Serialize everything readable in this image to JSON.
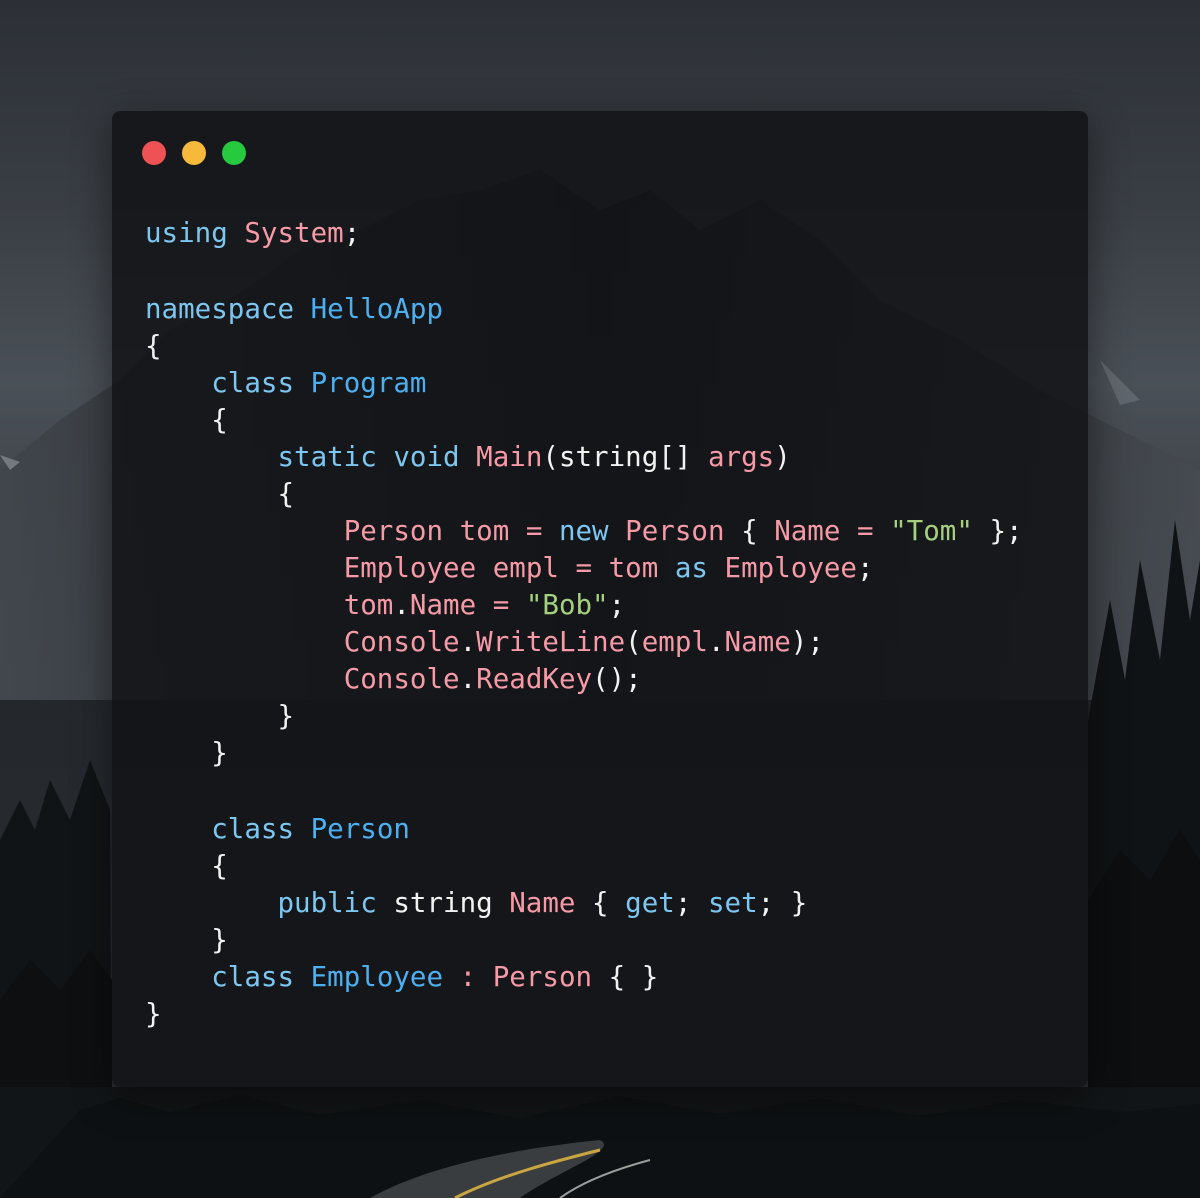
{
  "window": {
    "controls": [
      {
        "name": "close",
        "color": "#ef5254"
      },
      {
        "name": "minimize",
        "color": "#f6b93b"
      },
      {
        "name": "maximize",
        "color": "#27c93f"
      }
    ]
  },
  "colors": {
    "keyword": "#7cc6f0",
    "type": "#4cb0f0",
    "identifier": "#f59aa6",
    "string": "#a5d17f",
    "plain": "#f2f2f2"
  },
  "code_lines": [
    [
      {
        "t": "using",
        "c": "keyword"
      },
      {
        "t": " ",
        "c": "plain"
      },
      {
        "t": "System",
        "c": "identifier"
      },
      {
        "t": ";",
        "c": "plain"
      }
    ],
    [],
    [
      {
        "t": "namespace",
        "c": "keyword"
      },
      {
        "t": " ",
        "c": "plain"
      },
      {
        "t": "HelloApp",
        "c": "type"
      }
    ],
    [
      {
        "t": "{",
        "c": "plain"
      }
    ],
    [
      {
        "t": "    ",
        "c": "plain"
      },
      {
        "t": "class",
        "c": "keyword"
      },
      {
        "t": " ",
        "c": "plain"
      },
      {
        "t": "Program",
        "c": "type"
      }
    ],
    [
      {
        "t": "    {",
        "c": "plain"
      }
    ],
    [
      {
        "t": "        ",
        "c": "plain"
      },
      {
        "t": "static",
        "c": "keyword"
      },
      {
        "t": " ",
        "c": "plain"
      },
      {
        "t": "void",
        "c": "keyword"
      },
      {
        "t": " ",
        "c": "plain"
      },
      {
        "t": "Main",
        "c": "identifier"
      },
      {
        "t": "(string[] ",
        "c": "plain"
      },
      {
        "t": "args",
        "c": "identifier"
      },
      {
        "t": ")",
        "c": "plain"
      }
    ],
    [
      {
        "t": "        {",
        "c": "plain"
      }
    ],
    [
      {
        "t": "            ",
        "c": "plain"
      },
      {
        "t": "Person",
        "c": "identifier"
      },
      {
        "t": " ",
        "c": "plain"
      },
      {
        "t": "tom",
        "c": "identifier"
      },
      {
        "t": " = ",
        "c": "identifier"
      },
      {
        "t": "new",
        "c": "keyword"
      },
      {
        "t": " ",
        "c": "plain"
      },
      {
        "t": "Person",
        "c": "identifier"
      },
      {
        "t": " { ",
        "c": "plain"
      },
      {
        "t": "Name",
        "c": "identifier"
      },
      {
        "t": " = ",
        "c": "identifier"
      },
      {
        "t": "\"Tom\"",
        "c": "string"
      },
      {
        "t": " };",
        "c": "plain"
      }
    ],
    [
      {
        "t": "            ",
        "c": "plain"
      },
      {
        "t": "Employee",
        "c": "identifier"
      },
      {
        "t": " ",
        "c": "plain"
      },
      {
        "t": "empl",
        "c": "identifier"
      },
      {
        "t": " = ",
        "c": "identifier"
      },
      {
        "t": "tom",
        "c": "identifier"
      },
      {
        "t": " ",
        "c": "plain"
      },
      {
        "t": "as",
        "c": "keyword"
      },
      {
        "t": " ",
        "c": "plain"
      },
      {
        "t": "Employee",
        "c": "identifier"
      },
      {
        "t": ";",
        "c": "plain"
      }
    ],
    [
      {
        "t": "            ",
        "c": "plain"
      },
      {
        "t": "tom",
        "c": "identifier"
      },
      {
        "t": ".",
        "c": "plain"
      },
      {
        "t": "Name",
        "c": "identifier"
      },
      {
        "t": " = ",
        "c": "identifier"
      },
      {
        "t": "\"Bob\"",
        "c": "string"
      },
      {
        "t": ";",
        "c": "plain"
      }
    ],
    [
      {
        "t": "            ",
        "c": "plain"
      },
      {
        "t": "Console",
        "c": "identifier"
      },
      {
        "t": ".",
        "c": "plain"
      },
      {
        "t": "WriteLine",
        "c": "identifier"
      },
      {
        "t": "(",
        "c": "plain"
      },
      {
        "t": "empl",
        "c": "identifier"
      },
      {
        "t": ".",
        "c": "plain"
      },
      {
        "t": "Name",
        "c": "identifier"
      },
      {
        "t": ");",
        "c": "plain"
      }
    ],
    [
      {
        "t": "            ",
        "c": "plain"
      },
      {
        "t": "Console",
        "c": "identifier"
      },
      {
        "t": ".",
        "c": "plain"
      },
      {
        "t": "ReadKey",
        "c": "identifier"
      },
      {
        "t": "();",
        "c": "plain"
      }
    ],
    [
      {
        "t": "        }",
        "c": "plain"
      }
    ],
    [
      {
        "t": "    }",
        "c": "plain"
      }
    ],
    [],
    [
      {
        "t": "    ",
        "c": "plain"
      },
      {
        "t": "class",
        "c": "keyword"
      },
      {
        "t": " ",
        "c": "plain"
      },
      {
        "t": "Person",
        "c": "type"
      }
    ],
    [
      {
        "t": "    {",
        "c": "plain"
      }
    ],
    [
      {
        "t": "        ",
        "c": "plain"
      },
      {
        "t": "public",
        "c": "keyword"
      },
      {
        "t": " string ",
        "c": "plain"
      },
      {
        "t": "Name",
        "c": "identifier"
      },
      {
        "t": " { ",
        "c": "plain"
      },
      {
        "t": "get",
        "c": "keyword"
      },
      {
        "t": "; ",
        "c": "plain"
      },
      {
        "t": "set",
        "c": "keyword"
      },
      {
        "t": "; }",
        "c": "plain"
      }
    ],
    [
      {
        "t": "    }",
        "c": "plain"
      }
    ],
    [
      {
        "t": "    ",
        "c": "plain"
      },
      {
        "t": "class",
        "c": "keyword"
      },
      {
        "t": " ",
        "c": "plain"
      },
      {
        "t": "Employee",
        "c": "type"
      },
      {
        "t": " ",
        "c": "plain"
      },
      {
        "t": ":",
        "c": "identifier"
      },
      {
        "t": " ",
        "c": "plain"
      },
      {
        "t": "Person",
        "c": "identifier"
      },
      {
        "t": " { }",
        "c": "plain"
      }
    ],
    [
      {
        "t": "}",
        "c": "plain"
      }
    ]
  ]
}
